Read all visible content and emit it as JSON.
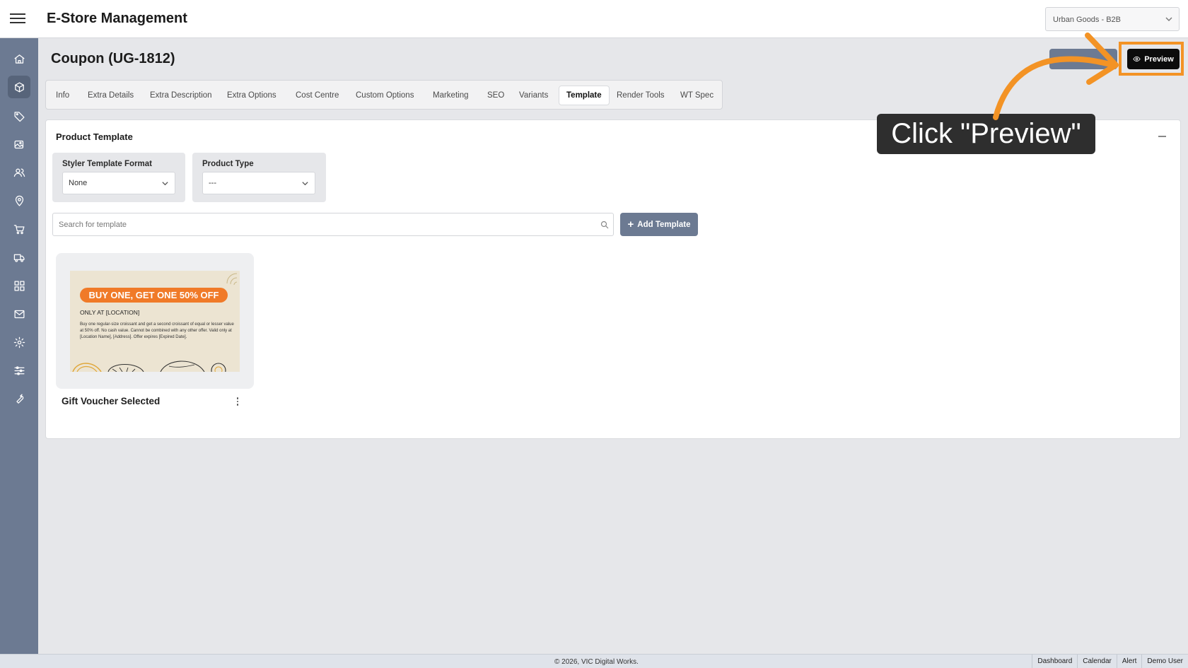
{
  "app": {
    "title": "E-Store Management",
    "store_selector": "Urban Goods - B2B"
  },
  "sidebar": {
    "items": [
      {
        "icon": "home-icon"
      },
      {
        "icon": "box-icon"
      },
      {
        "icon": "tag-icon"
      },
      {
        "icon": "images-icon"
      },
      {
        "icon": "users-icon"
      },
      {
        "icon": "location-icon"
      },
      {
        "icon": "cart-icon"
      },
      {
        "icon": "truck-icon"
      },
      {
        "icon": "grid-icon"
      },
      {
        "icon": "mail-icon"
      },
      {
        "icon": "gear-icon"
      },
      {
        "icon": "sliders-icon"
      },
      {
        "icon": "wrench-icon"
      }
    ],
    "active_index": 1
  },
  "page": {
    "title": "Coupon (UG-1812)",
    "preview_label": "Preview"
  },
  "tabs": [
    {
      "label": "Info"
    },
    {
      "label": "Extra Details"
    },
    {
      "label": "Extra Description"
    },
    {
      "label": "Extra Options"
    },
    {
      "label": "Cost Centre"
    },
    {
      "label": "Custom Options"
    },
    {
      "label": "Marketing"
    },
    {
      "label": "SEO"
    },
    {
      "label": "Variants"
    },
    {
      "label": "Template"
    },
    {
      "label": "Render Tools"
    },
    {
      "label": "WT Spec"
    }
  ],
  "active_tab": "Template",
  "panel": {
    "title": "Product Template",
    "styler_label": "Styler Template Format",
    "styler_value": "None",
    "product_type_label": "Product Type",
    "product_type_value": "---",
    "search_placeholder": "Search for template",
    "add_template_label": "Add Template"
  },
  "template_card": {
    "name": "Gift Voucher Selected",
    "coupon_headline": "BUY ONE, GET ONE 50% OFF",
    "coupon_sub": "ONLY AT [LOCATION]",
    "coupon_body": "Buy one regular-size croissant and get a second croissant of equal or lesser value at 50% off. No cash value. Cannot be combined with any other offer. Valid only at [Location Name], [Address]. Offer expires [Expired Date]."
  },
  "overlay": {
    "tooltip": "Click \"Preview\"",
    "accent": "#f39325"
  },
  "footer": {
    "copyright": "© 2026, VIC Digital Works.",
    "links": [
      "Dashboard",
      "Calendar",
      "Alert",
      "Demo User"
    ]
  },
  "colors": {
    "sidebar": "#6c7a92",
    "accent_button": "#6c7a92",
    "coupon_orange": "#f07a28"
  }
}
